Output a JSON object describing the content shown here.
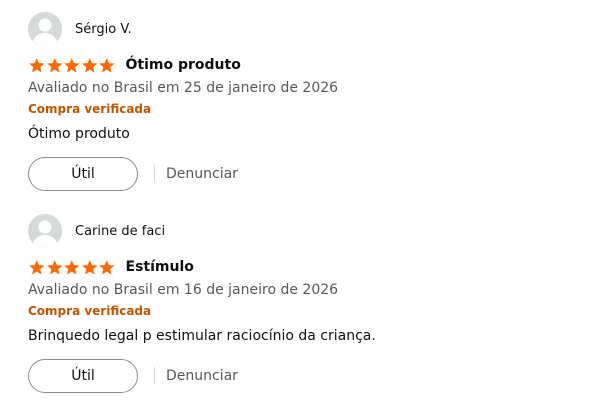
{
  "colors": {
    "star": "#ff6a00",
    "verified": "#c45500",
    "secondary_text": "#565959",
    "primary_text": "#0f1111",
    "avatar_bg": "#d5d9d9",
    "avatar_fg": "#ffffff"
  },
  "reviews": [
    {
      "author": "Sérgio V.",
      "rating": 5,
      "title": "Ótimo produto",
      "date": "Avaliado no Brasil em 25 de janeiro de 2026",
      "verified": "Compra verificada",
      "body": "Ótimo produto",
      "helpful_label": "Útil",
      "report_label": "Denunciar",
      "avatar_icon": "user-silhouette-icon"
    },
    {
      "author": "Carine de faci",
      "rating": 5,
      "title": "Estímulo",
      "date": "Avaliado no Brasil em 16 de janeiro de 2026",
      "verified": "Compra verificada",
      "body": "Brinquedo legal p estimular raciocínio da criança.",
      "helpful_label": "Útil",
      "report_label": "Denunciar",
      "avatar_icon": "user-silhouette-icon"
    }
  ]
}
